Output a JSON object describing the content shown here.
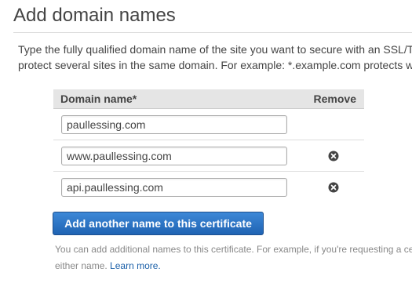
{
  "header": {
    "title": "Add domain names"
  },
  "description": {
    "line1": "Type the fully qualified domain name of the site you want to secure with an SSL/T",
    "line2": "protect several sites in the same domain. For example: *.example.com protects w"
  },
  "table": {
    "col_domain": "Domain name*",
    "col_remove": "Remove",
    "rows": [
      {
        "value": "paullessing.com",
        "removable": false
      },
      {
        "value": "www.paullessing.com",
        "removable": true
      },
      {
        "value": "api.paullessing.com",
        "removable": true
      }
    ]
  },
  "add_button_label": "Add another name to this certificate",
  "help": {
    "line1": "You can add additional names to this certificate. For example, if you're requesting a ce",
    "line2_prefix": "either name. ",
    "learn_more": "Learn more."
  },
  "icons": {
    "remove": "remove-circle-x-icon"
  }
}
